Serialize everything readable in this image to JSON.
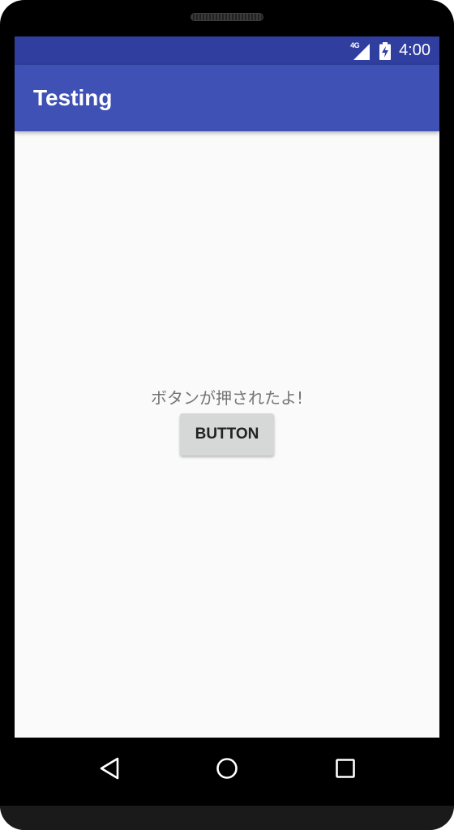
{
  "status_bar": {
    "network_type": "4G",
    "time": "4:00",
    "icons": [
      "signal-icon",
      "battery-charging-icon"
    ]
  },
  "app_bar": {
    "title": "Testing"
  },
  "main": {
    "message": "ボタンが押されたよ!",
    "button_label": "BUTTON"
  },
  "navigation": {
    "icons": [
      "back-icon",
      "home-icon",
      "recents-icon"
    ]
  },
  "colors": {
    "status_bar": "#303f9f",
    "app_bar": "#3f51b5",
    "background": "#fafafa",
    "button": "#d6d7d7"
  }
}
